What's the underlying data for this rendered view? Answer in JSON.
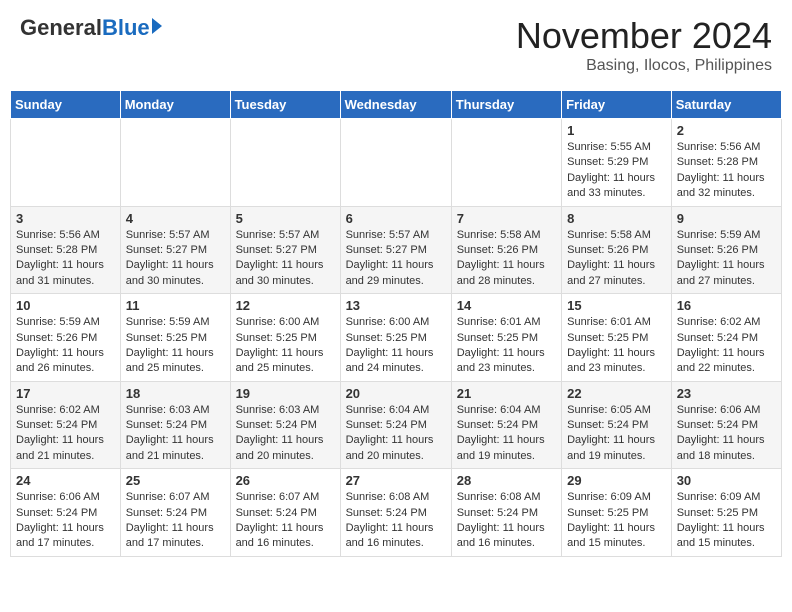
{
  "header": {
    "logo_general": "General",
    "logo_blue": "Blue",
    "month_title": "November 2024",
    "location": "Basing, Ilocos, Philippines"
  },
  "days_of_week": [
    "Sunday",
    "Monday",
    "Tuesday",
    "Wednesday",
    "Thursday",
    "Friday",
    "Saturday"
  ],
  "weeks": [
    [
      {
        "day": "",
        "info": ""
      },
      {
        "day": "",
        "info": ""
      },
      {
        "day": "",
        "info": ""
      },
      {
        "day": "",
        "info": ""
      },
      {
        "day": "",
        "info": ""
      },
      {
        "day": "1",
        "info": "Sunrise: 5:55 AM\nSunset: 5:29 PM\nDaylight: 11 hours and 33 minutes."
      },
      {
        "day": "2",
        "info": "Sunrise: 5:56 AM\nSunset: 5:28 PM\nDaylight: 11 hours and 32 minutes."
      }
    ],
    [
      {
        "day": "3",
        "info": "Sunrise: 5:56 AM\nSunset: 5:28 PM\nDaylight: 11 hours and 31 minutes."
      },
      {
        "day": "4",
        "info": "Sunrise: 5:57 AM\nSunset: 5:27 PM\nDaylight: 11 hours and 30 minutes."
      },
      {
        "day": "5",
        "info": "Sunrise: 5:57 AM\nSunset: 5:27 PM\nDaylight: 11 hours and 30 minutes."
      },
      {
        "day": "6",
        "info": "Sunrise: 5:57 AM\nSunset: 5:27 PM\nDaylight: 11 hours and 29 minutes."
      },
      {
        "day": "7",
        "info": "Sunrise: 5:58 AM\nSunset: 5:26 PM\nDaylight: 11 hours and 28 minutes."
      },
      {
        "day": "8",
        "info": "Sunrise: 5:58 AM\nSunset: 5:26 PM\nDaylight: 11 hours and 27 minutes."
      },
      {
        "day": "9",
        "info": "Sunrise: 5:59 AM\nSunset: 5:26 PM\nDaylight: 11 hours and 27 minutes."
      }
    ],
    [
      {
        "day": "10",
        "info": "Sunrise: 5:59 AM\nSunset: 5:26 PM\nDaylight: 11 hours and 26 minutes."
      },
      {
        "day": "11",
        "info": "Sunrise: 5:59 AM\nSunset: 5:25 PM\nDaylight: 11 hours and 25 minutes."
      },
      {
        "day": "12",
        "info": "Sunrise: 6:00 AM\nSunset: 5:25 PM\nDaylight: 11 hours and 25 minutes."
      },
      {
        "day": "13",
        "info": "Sunrise: 6:00 AM\nSunset: 5:25 PM\nDaylight: 11 hours and 24 minutes."
      },
      {
        "day": "14",
        "info": "Sunrise: 6:01 AM\nSunset: 5:25 PM\nDaylight: 11 hours and 23 minutes."
      },
      {
        "day": "15",
        "info": "Sunrise: 6:01 AM\nSunset: 5:25 PM\nDaylight: 11 hours and 23 minutes."
      },
      {
        "day": "16",
        "info": "Sunrise: 6:02 AM\nSunset: 5:24 PM\nDaylight: 11 hours and 22 minutes."
      }
    ],
    [
      {
        "day": "17",
        "info": "Sunrise: 6:02 AM\nSunset: 5:24 PM\nDaylight: 11 hours and 21 minutes."
      },
      {
        "day": "18",
        "info": "Sunrise: 6:03 AM\nSunset: 5:24 PM\nDaylight: 11 hours and 21 minutes."
      },
      {
        "day": "19",
        "info": "Sunrise: 6:03 AM\nSunset: 5:24 PM\nDaylight: 11 hours and 20 minutes."
      },
      {
        "day": "20",
        "info": "Sunrise: 6:04 AM\nSunset: 5:24 PM\nDaylight: 11 hours and 20 minutes."
      },
      {
        "day": "21",
        "info": "Sunrise: 6:04 AM\nSunset: 5:24 PM\nDaylight: 11 hours and 19 minutes."
      },
      {
        "day": "22",
        "info": "Sunrise: 6:05 AM\nSunset: 5:24 PM\nDaylight: 11 hours and 19 minutes."
      },
      {
        "day": "23",
        "info": "Sunrise: 6:06 AM\nSunset: 5:24 PM\nDaylight: 11 hours and 18 minutes."
      }
    ],
    [
      {
        "day": "24",
        "info": "Sunrise: 6:06 AM\nSunset: 5:24 PM\nDaylight: 11 hours and 17 minutes."
      },
      {
        "day": "25",
        "info": "Sunrise: 6:07 AM\nSunset: 5:24 PM\nDaylight: 11 hours and 17 minutes."
      },
      {
        "day": "26",
        "info": "Sunrise: 6:07 AM\nSunset: 5:24 PM\nDaylight: 11 hours and 16 minutes."
      },
      {
        "day": "27",
        "info": "Sunrise: 6:08 AM\nSunset: 5:24 PM\nDaylight: 11 hours and 16 minutes."
      },
      {
        "day": "28",
        "info": "Sunrise: 6:08 AM\nSunset: 5:24 PM\nDaylight: 11 hours and 16 minutes."
      },
      {
        "day": "29",
        "info": "Sunrise: 6:09 AM\nSunset: 5:25 PM\nDaylight: 11 hours and 15 minutes."
      },
      {
        "day": "30",
        "info": "Sunrise: 6:09 AM\nSunset: 5:25 PM\nDaylight: 11 hours and 15 minutes."
      }
    ]
  ]
}
